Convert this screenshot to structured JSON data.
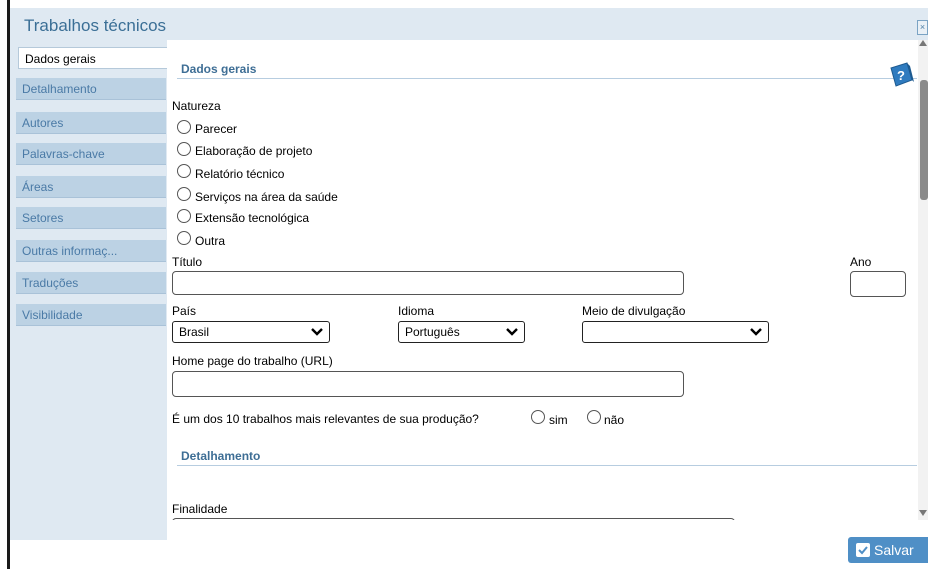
{
  "window": {
    "title": "Trabalhos técnicos",
    "close_glyph": "×"
  },
  "sidebar": {
    "items": [
      {
        "label": "Dados gerais"
      },
      {
        "label": "Detalhamento"
      },
      {
        "label": "Autores"
      },
      {
        "label": "Palavras-chave"
      },
      {
        "label": "Áreas"
      },
      {
        "label": "Setores"
      },
      {
        "label": "Outras informaç..."
      },
      {
        "label": "Traduções"
      },
      {
        "label": "Visibilidade"
      }
    ]
  },
  "sections": {
    "dados_gerais": "Dados gerais",
    "detalhamento": "Detalhamento"
  },
  "form": {
    "natureza_label": "Natureza",
    "natureza_options": [
      "Parecer",
      "Elaboração de projeto",
      "Relatório técnico",
      "Serviços na área da saúde",
      "Extensão tecnológica",
      "Outra"
    ],
    "titulo_label": "Título",
    "titulo_value": "",
    "ano_label": "Ano",
    "ano_value": "",
    "pais_label": "País",
    "pais_value": "Brasil",
    "idioma_label": "Idioma",
    "idioma_value": "Português",
    "meio_label": "Meio de divulgação",
    "meio_value": "",
    "homepage_label": "Home page do trabalho (URL)",
    "homepage_value": "",
    "relevante_question": "É um dos 10 trabalhos mais relevantes de sua produção?",
    "relevante_sim": "sim",
    "relevante_nao": "não",
    "finalidade_label": "Finalidade"
  },
  "footer": {
    "save_label": "Salvar"
  },
  "icons": {
    "help": "help-icon",
    "save": "check-icon",
    "dropdown": "chevron-down-icon"
  },
  "colors": {
    "accent": "#4f8fc6",
    "title_text": "#3b6f96",
    "tab_bg": "#bcd2e4",
    "panel_bg": "#dfe9f2"
  }
}
